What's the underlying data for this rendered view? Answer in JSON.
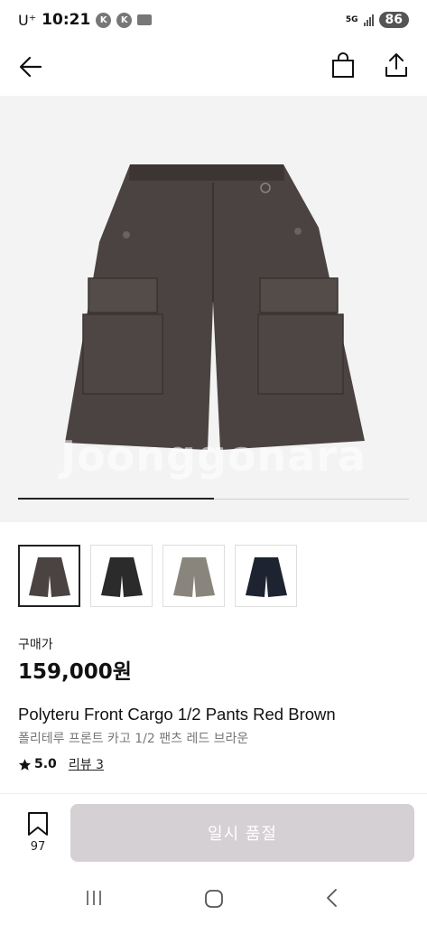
{
  "status_bar": {
    "carrier": "U⁺",
    "time": "10:21",
    "notification_icons": [
      "kakaotalk-icon",
      "kakaotalk-icon",
      "message-icon"
    ],
    "network": "5G",
    "battery": "86"
  },
  "header": {
    "icons": [
      "back-arrow-icon",
      "shopping-bag-icon",
      "share-icon"
    ]
  },
  "hero": {
    "watermark": "Joonggonara",
    "image_progress": 0.5,
    "background": "#f3f3f3"
  },
  "thumbnails": [
    {
      "name": "red-brown",
      "color": "#4a4341",
      "selected": true
    },
    {
      "name": "black",
      "color": "#2b2b2b",
      "selected": false
    },
    {
      "name": "grey-beige",
      "color": "#8a857c",
      "selected": false
    },
    {
      "name": "navy",
      "color": "#1d2330",
      "selected": false
    }
  ],
  "product": {
    "price_label": "구매가",
    "price": "159,000원",
    "title_en": "Polyteru Front Cargo 1/2 Pants Red Brown",
    "title_ko": "폴리테루 프론트 카고 1/2 팬츠 레드 브라운",
    "rating": "5.0",
    "review_label": "리뷰 3"
  },
  "bottom_bar": {
    "bookmark_count": "97",
    "action_label": "일시 품절",
    "action_color": "#d4d0d3"
  },
  "nav_bar": {
    "icons": [
      "recent-apps-icon",
      "home-icon",
      "back-icon"
    ]
  }
}
